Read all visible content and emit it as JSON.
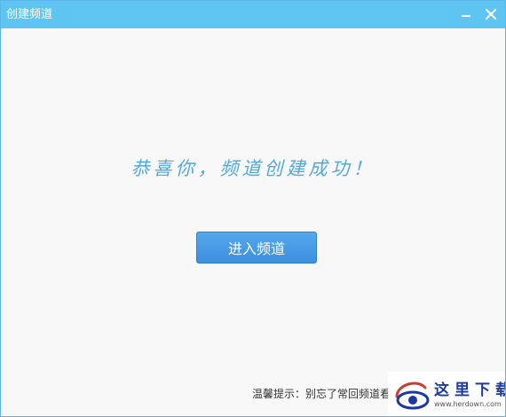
{
  "window": {
    "title": "创建频道",
    "minimize_icon": "minimize-icon",
    "close_icon": "close-icon",
    "titlebar_color": "#5ec5f2"
  },
  "main": {
    "message": "恭喜你，频道创建成功！",
    "enter_button_label": "进入频道",
    "tip": "温馨提示：别忘了常回频道看"
  },
  "watermark": {
    "title": "这里下载",
    "url": "www.herdown.com"
  },
  "colors": {
    "accent": "#52a9da",
    "button": "#3d8fe0"
  }
}
